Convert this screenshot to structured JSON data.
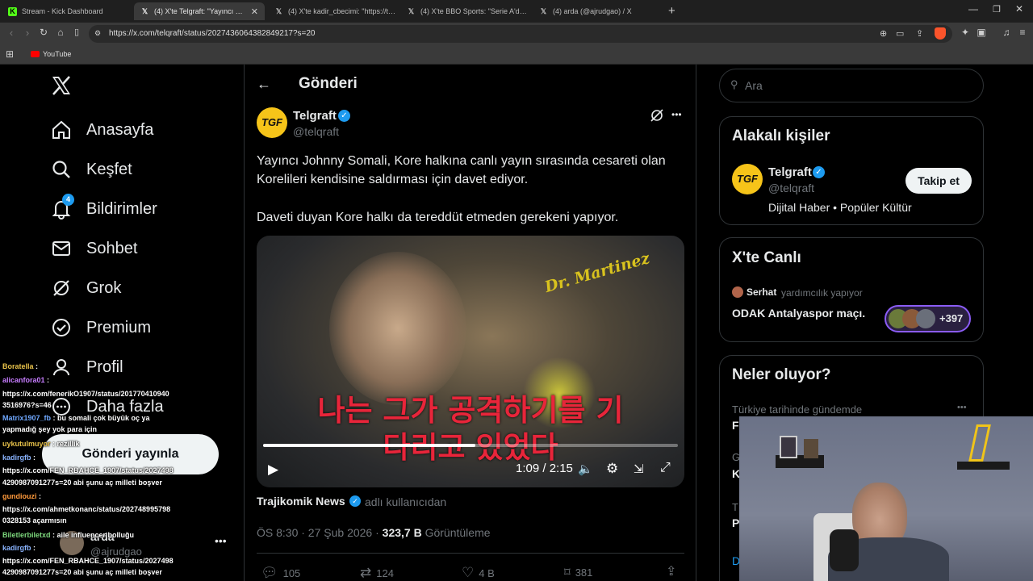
{
  "browser": {
    "tabs": [
      {
        "title": "Stream - Kick Dashboard",
        "icon": "kick-icon"
      },
      {
        "title": "(4) X'te Telgraft: \"Yayıncı Johnny",
        "icon": "x-icon"
      },
      {
        "title": "(4) X'te kadir_cbecimi: \"https://t.co/l",
        "icon": "x-icon"
      },
      {
        "title": "(4) X'te BBO Sports: \"Serie A'da belki",
        "icon": "x-icon"
      },
      {
        "title": "(4) arda (@ajrudgao) / X",
        "icon": "x-icon"
      }
    ],
    "url": "https://x.com/telqraft/status/2027436064382849217?s=20",
    "bookmark": "YouTube"
  },
  "sidebar": {
    "items": [
      {
        "label": "Anasayfa",
        "icon": "home-icon"
      },
      {
        "label": "Keşfet",
        "icon": "search-icon"
      },
      {
        "label": "Bildirimler",
        "icon": "bell-icon",
        "badge": "4"
      },
      {
        "label": "Sohbet",
        "icon": "mail-icon"
      },
      {
        "label": "Grok",
        "icon": "grok-icon"
      },
      {
        "label": "Premium",
        "icon": "verified-icon"
      },
      {
        "label": "Profil",
        "icon": "person-icon"
      },
      {
        "label": "Daha fazla",
        "icon": "more-circle-icon"
      }
    ],
    "post_button": "Gönderi yayınla",
    "account": {
      "name": "arda",
      "handle": "@ajrudgao"
    }
  },
  "post": {
    "header_title": "Gönderi",
    "author": {
      "name": "Telgraft",
      "handle": "@telqraft",
      "avatar_text": "TGF"
    },
    "text1": "Yayıncı Johnny Somali, Kore halkına canlı yayın sırasında cesareti olan Korelileri kendisine saldırması için davet ediyor.",
    "text2": "Daveti duyan Kore halkı da tereddüt etmeden gerekeni yapıyor.",
    "video": {
      "subtitle1": "나는 그가 공격하기를 기",
      "subtitle2": "다리고 있었다",
      "sign": "Dr. Martinez",
      "time": "1:09 / 2:15",
      "progress": 0.511
    },
    "source_name": "Trajikomik News",
    "source_suffix": "adlı kullanıcıdan",
    "meta_time": "ÖS 8:30 · 27 Şub 2026 · ",
    "views_count": "323,7 B",
    "views_label": "Görüntüleme",
    "stats": {
      "replies": "105",
      "reposts": "124",
      "likes": "4 B",
      "bookmarks": "381"
    }
  },
  "right": {
    "search_placeholder": "Ara",
    "related_title": "Alakalı kişiler",
    "related": {
      "name": "Telgraft",
      "handle": "@telqraft",
      "bio": "Dijital Haber • Popüler Kültür",
      "follow": "Takip et"
    },
    "live_title": "X'te Canlı",
    "live": {
      "host": "Serhat",
      "host_suffix": "yardımcılık yapıyor",
      "title": "ODAK Antalyaspor maçı.",
      "count": "+397"
    },
    "trends_title": "Neler oluyor?",
    "trends_line": "Türkiye tarihinde gündemde",
    "trend_letters": [
      "Fe",
      "G",
      "K",
      "Tü",
      "P",
      "D"
    ]
  },
  "chat": [
    {
      "user": "Boratella",
      "user_color": "#e8c24a",
      "msg": ""
    },
    {
      "user": "alicanfora01",
      "user_color": "#c77dff",
      "msg": ""
    },
    {
      "user": "",
      "user_color": "#fff",
      "msg": "https://x.com/fenerikO1907/status/201770410940"
    },
    {
      "user": "",
      "user_color": "#fff",
      "msg": "3516976?s=46"
    },
    {
      "user": "Matrix1907_fb",
      "user_color": "#6fa8ff",
      "msg": "bu somali çok büyük oç ya"
    },
    {
      "user": "",
      "user_color": "#fff",
      "msg": "yapmadığ şey yok para için"
    },
    {
      "user": "uykutulmuyor",
      "user_color": "#e8c24a",
      "msg": "rezillik"
    },
    {
      "user": "kadirgfb",
      "user_color": "#8ab4ff",
      "msg": ""
    },
    {
      "user": "",
      "user_color": "#fff",
      "msg": "https://x.com/FEN_RBAHCE_1907/status/2027498"
    },
    {
      "user": "",
      "user_color": "#fff",
      "msg": "4290987091277s=20 abi şunu aç milleti boşver"
    },
    {
      "user": "gundiouzi",
      "user_color": "#ff9a3c",
      "msg": ""
    },
    {
      "user": "",
      "user_color": "#fff",
      "msg": "https://x.com/ahmetkonanc/status/202748995798"
    },
    {
      "user": "",
      "user_color": "#fff",
      "msg": "0328153 açarmısın"
    },
    {
      "user": "Biletlerbiletxd",
      "user_color": "#7cd67c",
      "msg": "aile influencer bolluğu"
    },
    {
      "user": "kadirgfb",
      "user_color": "#8ab4ff",
      "msg": ""
    },
    {
      "user": "",
      "user_color": "#fff",
      "msg": "https://x.com/FEN_RBAHCE_1907/status/2027498"
    },
    {
      "user": "",
      "user_color": "#fff",
      "msg": "4290987091277s=20 abi şunu aç milleti boşver"
    }
  ],
  "colors": {
    "accent": "#1d9bf0",
    "badge": "#1d9bf0",
    "avatar": "#f6c419",
    "live_border": "#8b5cf6"
  }
}
